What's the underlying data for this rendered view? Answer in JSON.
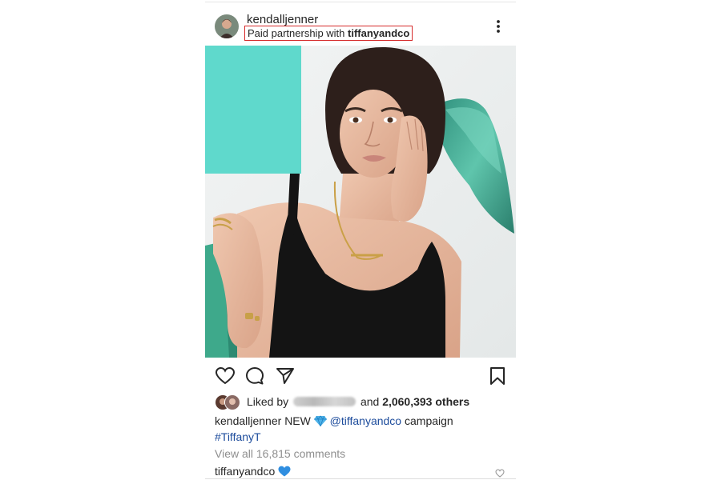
{
  "post": {
    "username": "kendalljenner",
    "sponsor_prefix": "Paid partnership with",
    "sponsor_name": "tiffanyandco",
    "likes": {
      "prefix": "Liked by",
      "connector": "and",
      "count": "2,060,393 others"
    },
    "caption": {
      "username": "kendalljenner",
      "text_before": "NEW",
      "mention": "@tiffanyandco",
      "text_after": "campaign",
      "hashtag": "#TiffanyT"
    },
    "view_comments": "View all 16,815 comments",
    "comment": {
      "username": "tiffanyandco"
    }
  },
  "icons": {
    "more": "more-vertical-icon",
    "like": "heart-icon",
    "comment": "comment-icon",
    "share": "send-icon",
    "save": "bookmark-icon",
    "gem": "diamond-emoji",
    "blue_heart": "blue-heart-emoji"
  },
  "colors": {
    "sponsor_box": "#d62b2b",
    "link": "#1d4c9c",
    "muted": "#8e8e8e",
    "tiffany_blue": "#5fd9cc"
  }
}
